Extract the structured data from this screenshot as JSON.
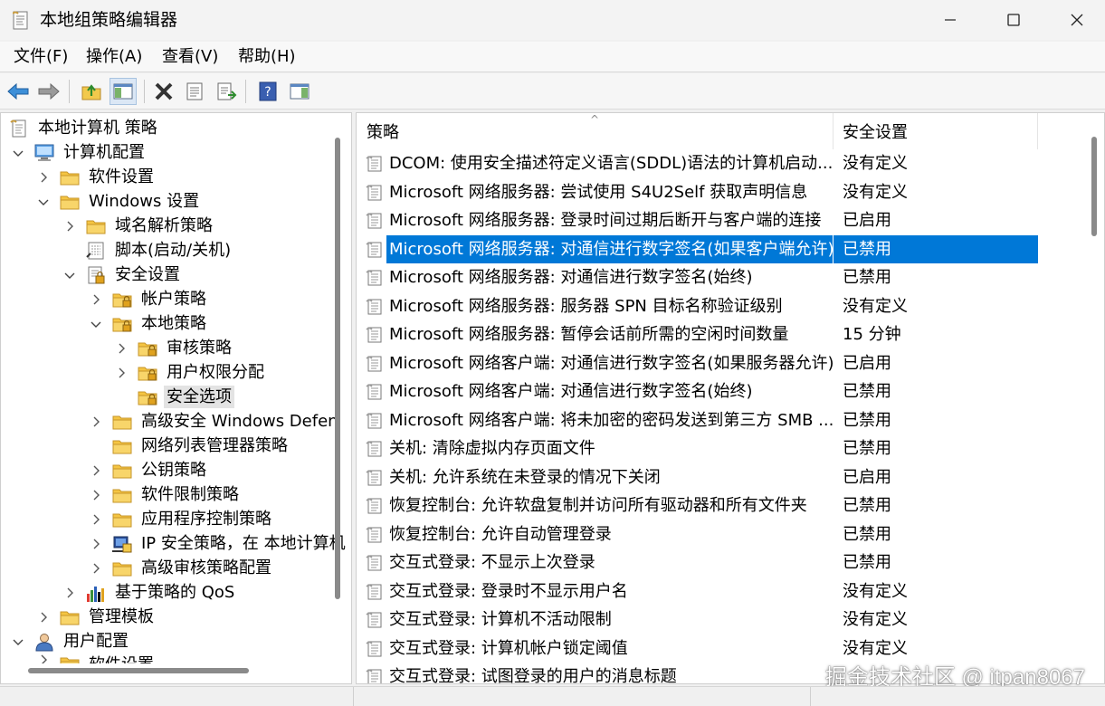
{
  "window": {
    "title": "本地组策略编辑器"
  },
  "menu": [
    "文件(F)",
    "操作(A)",
    "查看(V)",
    "帮助(H)"
  ],
  "tree": {
    "root": "本地计算机 策略",
    "computer_config": "计算机配置",
    "software_settings": "软件设置",
    "windows_settings": "Windows 设置",
    "name_resolution": "域名解析策略",
    "scripts": "脚本(启动/关机)",
    "security_settings": "安全设置",
    "account_policies": "帐户策略",
    "local_policies": "本地策略",
    "audit_policy": "审核策略",
    "user_rights": "用户权限分配",
    "security_options": "安全选项",
    "advanced_firewall": "高级安全 Windows Defen",
    "network_list": "网络列表管理器策略",
    "public_key": "公钥策略",
    "software_restriction": "软件限制策略",
    "app_control": "应用程序控制策略",
    "ip_security": "IP 安全策略，在 本地计算机",
    "advanced_audit": "高级审核策略配置",
    "qos": "基于策略的 QoS",
    "admin_templates": "管理模板",
    "user_config": "用户配置",
    "partial_row": "软件设置"
  },
  "columns": {
    "policy": "策略",
    "setting": "安全设置"
  },
  "policies": [
    {
      "policy": "DCOM: 使用安全描述符定义语言(SDDL)语法的计算机启动...",
      "setting": "没有定义"
    },
    {
      "policy": "Microsoft 网络服务器: 尝试使用 S4U2Self 获取声明信息",
      "setting": "没有定义"
    },
    {
      "policy": "Microsoft 网络服务器: 登录时间过期后断开与客户端的连接",
      "setting": "已启用"
    },
    {
      "policy": "Microsoft 网络服务器: 对通信进行数字签名(如果客户端允许)",
      "setting": "已禁用"
    },
    {
      "policy": "Microsoft 网络服务器: 对通信进行数字签名(始终)",
      "setting": "已禁用"
    },
    {
      "policy": "Microsoft 网络服务器: 服务器 SPN 目标名称验证级别",
      "setting": "没有定义"
    },
    {
      "policy": "Microsoft 网络服务器: 暂停会话前所需的空闲时间数量",
      "setting": "15 分钟"
    },
    {
      "policy": "Microsoft 网络客户端: 对通信进行数字签名(如果服务器允许)",
      "setting": "已启用"
    },
    {
      "policy": "Microsoft 网络客户端: 对通信进行数字签名(始终)",
      "setting": "已禁用"
    },
    {
      "policy": "Microsoft 网络客户端: 将未加密的密码发送到第三方 SMB ...",
      "setting": "已禁用"
    },
    {
      "policy": "关机: 清除虚拟内存页面文件",
      "setting": "已禁用"
    },
    {
      "policy": "关机: 允许系统在未登录的情况下关闭",
      "setting": "已启用"
    },
    {
      "policy": "恢复控制台: 允许软盘复制并访问所有驱动器和所有文件夹",
      "setting": "已禁用"
    },
    {
      "policy": "恢复控制台: 允许自动管理登录",
      "setting": "已禁用"
    },
    {
      "policy": "交互式登录: 不显示上次登录",
      "setting": "已禁用"
    },
    {
      "policy": "交互式登录: 登录时不显示用户名",
      "setting": "没有定义"
    },
    {
      "policy": "交互式登录: 计算机不活动限制",
      "setting": "没有定义"
    },
    {
      "policy": "交互式登录: 计算机帐户锁定阈值",
      "setting": "没有定义"
    },
    {
      "policy": "交互式登录: 试图登录的用户的消息标题",
      "setting": ""
    }
  ],
  "selected_policy_index": 3,
  "watermark": "掘金技术社区 @ itpan8067",
  "colors": {
    "selection": "#0078d7",
    "folder": "#f5c542"
  }
}
